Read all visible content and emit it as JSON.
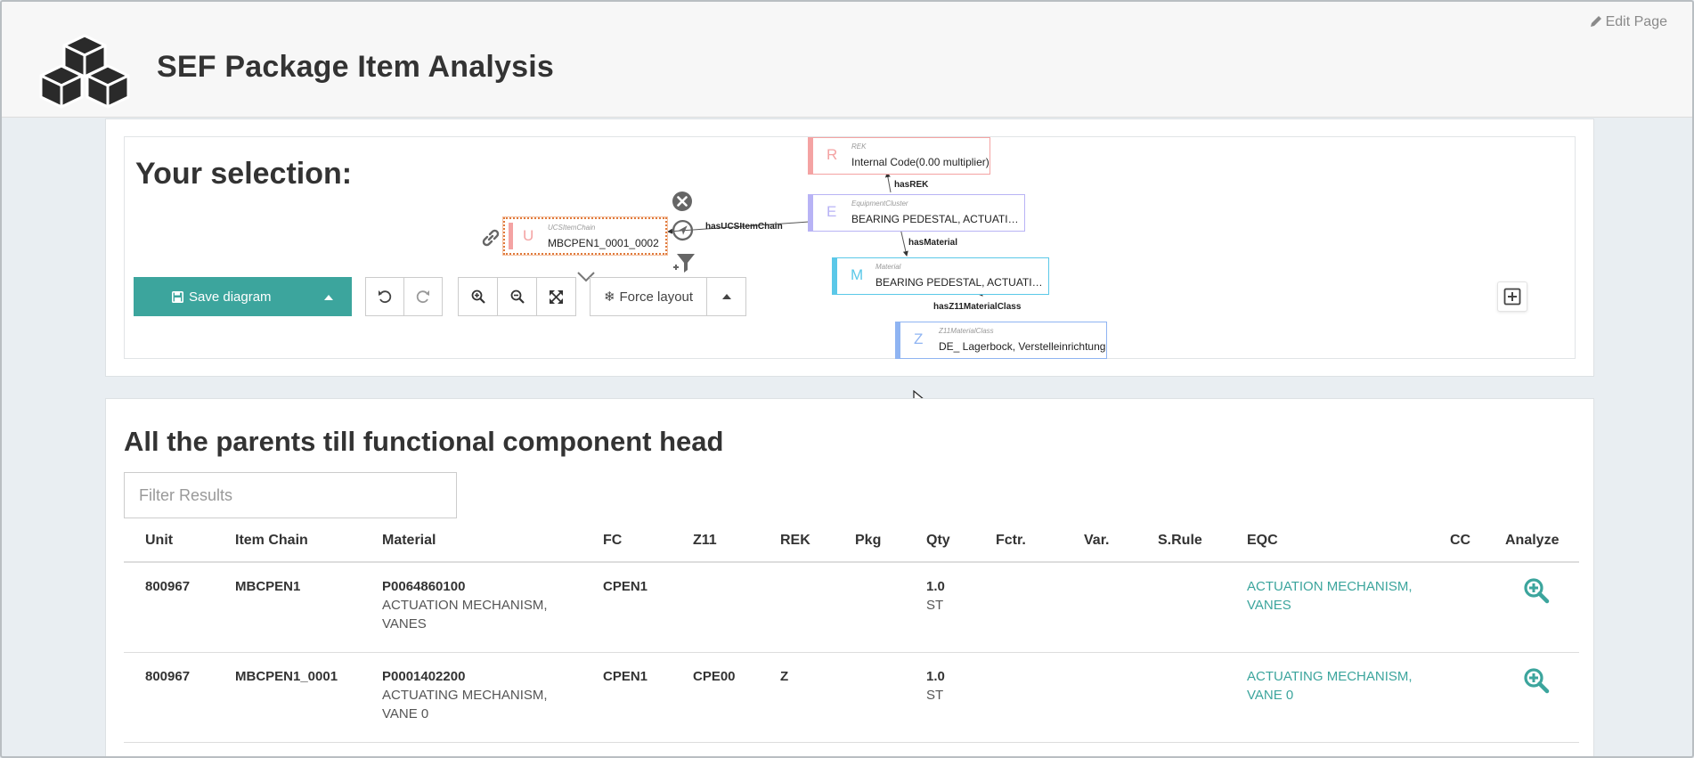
{
  "header": {
    "title": "SEF Package Item Analysis",
    "edit_label": "Edit Page"
  },
  "selection": {
    "title": "Your selection:",
    "graph": {
      "nodes": {
        "u": {
          "letter": "U",
          "type": "UCSItemChain",
          "label": "MBCPEN1_0001_0002",
          "color": "#f4a3a3"
        },
        "r": {
          "letter": "R",
          "type": "REK",
          "label": "Internal Code(0.00 multiplier)",
          "color": "#f4a3a3"
        },
        "e": {
          "letter": "E",
          "type": "EquipmentCluster",
          "label": "BEARING PEDESTAL, ACTUATI…",
          "color": "#b8b3f5"
        },
        "m": {
          "letter": "M",
          "type": "Material",
          "label": "BEARING PEDESTAL, ACTUATI…",
          "color": "#5bc8e8"
        },
        "z": {
          "letter": "Z",
          "type": "Z11MaterialClass",
          "label": "DE_ Lagerbock, Verstelleinrichtung",
          "color": "#8fb4f2"
        }
      },
      "edges": {
        "has_ucs": "hasUCSItemChain",
        "has_rek": "hasREK",
        "has_material": "hasMaterial",
        "has_z11": "hasZ11MaterialClass"
      }
    },
    "toolbar": {
      "save_label": "Save diagram",
      "force_label": "Force layout"
    }
  },
  "parents": {
    "title": "All the parents till functional component head",
    "filter_placeholder": "Filter Results",
    "columns": [
      "Unit",
      "Item Chain",
      "Material",
      "FC",
      "Z11",
      "REK",
      "Pkg",
      "Qty",
      "Fctr.",
      "Var.",
      "S.Rule",
      "EQC",
      "CC",
      "Analyze"
    ],
    "rows": [
      {
        "unit": "800967",
        "item_chain": "MBCPEN1",
        "material_code": "P0064860100",
        "material_desc": "ACTUATION MECHANISM, VANES",
        "fc": "CPEN1",
        "z11": "",
        "rek": "",
        "pkg": "",
        "qty": "1.0",
        "uom": "ST",
        "fctr": "",
        "var": "",
        "srule": "",
        "eqc": "ACTUATION MECHANISM, VANES",
        "cc": ""
      },
      {
        "unit": "800967",
        "item_chain": "MBCPEN1_0001",
        "material_code": "P0001402200",
        "material_desc": "ACTUATING MECHANISM, VANE 0",
        "fc": "CPEN1",
        "z11": "CPE00",
        "rek": "Z",
        "pkg": "",
        "qty": "1.0",
        "uom": "ST",
        "fctr": "",
        "var": "",
        "srule": "",
        "eqc": "ACTUATING MECHANISM, VANE 0",
        "cc": ""
      }
    ]
  },
  "colors": {
    "accent": "#3ca59d",
    "selected_node_border": "#e07a3c"
  }
}
